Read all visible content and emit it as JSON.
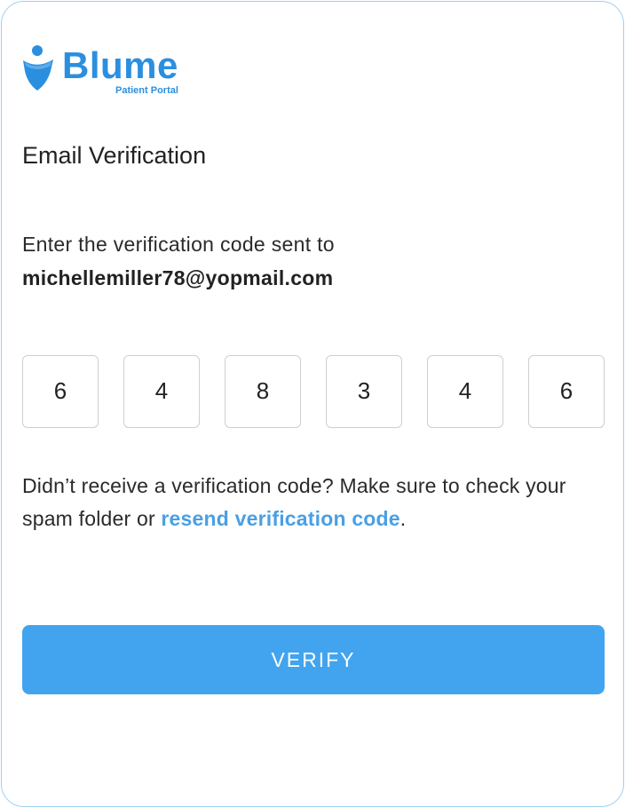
{
  "brand": {
    "name": "Blume",
    "subtitle": "Patient Portal",
    "logo_icon": "person-drop-icon",
    "color": "#2b8fe0"
  },
  "page": {
    "title": "Email Verification"
  },
  "instructions": {
    "prompt": "Enter the verification code sent to",
    "email": "michellemiller78@yopmail.com"
  },
  "code": {
    "digits": [
      "6",
      "4",
      "8",
      "3",
      "4",
      "6"
    ]
  },
  "help": {
    "text_before": "Didn’t receive a verification code? Make sure to check your spam folder or ",
    "link_label": "resend verification code",
    "text_after": ".",
    "link_color": "#4a9fe3"
  },
  "actions": {
    "verify_label": "VERIFY",
    "button_color": "#42a4ee"
  }
}
